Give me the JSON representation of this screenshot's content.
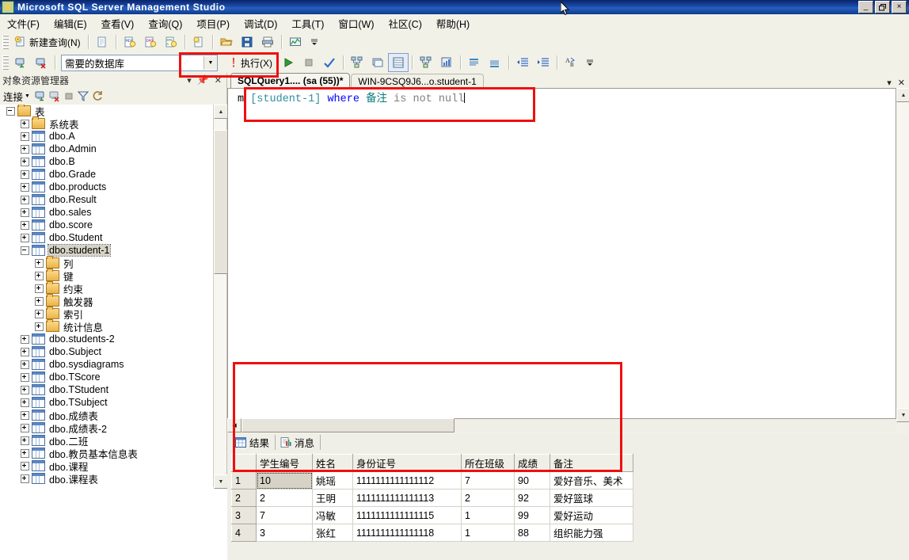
{
  "window": {
    "title": "Microsoft SQL Server Management Studio",
    "minimize": "_",
    "restore": "❐",
    "close": "×"
  },
  "menubar": {
    "items": [
      {
        "label": "文件(F)"
      },
      {
        "label": "编辑(E)"
      },
      {
        "label": "查看(V)"
      },
      {
        "label": "查询(Q)"
      },
      {
        "label": "项目(P)"
      },
      {
        "label": "调试(D)"
      },
      {
        "label": "工具(T)"
      },
      {
        "label": "窗口(W)"
      },
      {
        "label": "社区(C)"
      },
      {
        "label": "帮助(H)"
      }
    ]
  },
  "toolbar1": {
    "new_query_label": "新建查询(N)",
    "icons": [
      "new-query-icon",
      "new-database-engine-query-icon",
      "new-mdx-query-icon",
      "new-dmx-query-icon",
      "new-xmla-query-icon",
      "new-file-icon",
      "open-file-icon",
      "save-icon",
      "print-icon",
      "activity-monitor-icon",
      "toolbar-overflow-icon"
    ]
  },
  "toolbar2": {
    "database_value": "需要的数据库",
    "execute_label": "执行(X)",
    "icons": [
      "connect-object-explorer-icon",
      "disconnect-icon",
      "execute-warning-icon",
      "debug-play-icon",
      "stop-icon",
      "parse-check-icon",
      "display-estimated-plan-icon",
      "query-options-icon",
      "results-to-text-icon",
      "results-to-grid-icon",
      "results-to-file-icon",
      "include-actual-plan-icon",
      "include-client-statistics-icon",
      "comment-icon",
      "uncomment-icon",
      "decrease-indent-icon",
      "increase-indent-icon",
      "spell-check-icon",
      "toolbar-overflow-icon"
    ]
  },
  "object_explorer": {
    "title": "对象资源管理器",
    "connect_label": "连接",
    "toolbar_icons": [
      "connect-icon",
      "disconnect-icon",
      "stop-icon",
      "filter-icon",
      "refresh-icon"
    ],
    "header_icons": [
      "dropdown-icon",
      "pin-icon",
      "close-icon"
    ],
    "tree": [
      {
        "label": "表",
        "type": "folder",
        "indent": 0,
        "state": "minus"
      },
      {
        "label": "系统表",
        "type": "folder",
        "indent": 1,
        "state": "plus"
      },
      {
        "label": "dbo.A",
        "type": "table",
        "indent": 1,
        "state": "plus"
      },
      {
        "label": "dbo.Admin",
        "type": "table",
        "indent": 1,
        "state": "plus"
      },
      {
        "label": "dbo.B",
        "type": "table",
        "indent": 1,
        "state": "plus"
      },
      {
        "label": "dbo.Grade",
        "type": "table",
        "indent": 1,
        "state": "plus"
      },
      {
        "label": "dbo.products",
        "type": "table",
        "indent": 1,
        "state": "plus"
      },
      {
        "label": "dbo.Result",
        "type": "table",
        "indent": 1,
        "state": "plus"
      },
      {
        "label": "dbo.sales",
        "type": "table",
        "indent": 1,
        "state": "plus"
      },
      {
        "label": "dbo.score",
        "type": "table",
        "indent": 1,
        "state": "plus"
      },
      {
        "label": "dbo.Student",
        "type": "table",
        "indent": 1,
        "state": "plus"
      },
      {
        "label": "dbo.student-1",
        "type": "table",
        "indent": 1,
        "state": "minus",
        "selected": true
      },
      {
        "label": "列",
        "type": "folder",
        "indent": 2,
        "state": "plus"
      },
      {
        "label": "键",
        "type": "folder",
        "indent": 2,
        "state": "plus"
      },
      {
        "label": "约束",
        "type": "folder",
        "indent": 2,
        "state": "plus"
      },
      {
        "label": "触发器",
        "type": "folder",
        "indent": 2,
        "state": "plus"
      },
      {
        "label": "索引",
        "type": "folder",
        "indent": 2,
        "state": "plus"
      },
      {
        "label": "统计信息",
        "type": "folder",
        "indent": 2,
        "state": "plus"
      },
      {
        "label": "dbo.students-2",
        "type": "table",
        "indent": 1,
        "state": "plus"
      },
      {
        "label": "dbo.Subject",
        "type": "table",
        "indent": 1,
        "state": "plus"
      },
      {
        "label": "dbo.sysdiagrams",
        "type": "table",
        "indent": 1,
        "state": "plus"
      },
      {
        "label": "dbo.TScore",
        "type": "table",
        "indent": 1,
        "state": "plus"
      },
      {
        "label": "dbo.TStudent",
        "type": "table",
        "indent": 1,
        "state": "plus"
      },
      {
        "label": "dbo.TSubject",
        "type": "table",
        "indent": 1,
        "state": "plus"
      },
      {
        "label": "dbo.成绩表",
        "type": "table",
        "indent": 1,
        "state": "plus"
      },
      {
        "label": "dbo.成绩表-2",
        "type": "table",
        "indent": 1,
        "state": "plus"
      },
      {
        "label": "dbo.二班",
        "type": "table",
        "indent": 1,
        "state": "plus"
      },
      {
        "label": "dbo.教员基本信息表",
        "type": "table",
        "indent": 1,
        "state": "plus"
      },
      {
        "label": "dbo.课程",
        "type": "table",
        "indent": 1,
        "state": "plus"
      },
      {
        "label": "dbo.课程表",
        "type": "table",
        "indent": 1,
        "state": "plus"
      }
    ]
  },
  "editor": {
    "tabs": [
      {
        "label": "SQLQuery1.... (sa (55))*",
        "active": true
      },
      {
        "label": "WIN-9CSQ9J6...o.student-1",
        "active": false
      }
    ],
    "tab_icons": [
      "tab-dropdown-icon",
      "tab-close-icon"
    ],
    "code_tokens": [
      {
        "text": "m ",
        "cls": "k-plain"
      },
      {
        "text": "[student-1]",
        "cls": "k-ident"
      },
      {
        "text": " ",
        "cls": "k-plain"
      },
      {
        "text": "where",
        "cls": "k-kw"
      },
      {
        "text": " ",
        "cls": "k-plain"
      },
      {
        "text": "备注",
        "cls": "k-cn"
      },
      {
        "text": " ",
        "cls": "k-plain"
      },
      {
        "text": "is not null",
        "cls": "k-gray"
      }
    ]
  },
  "results": {
    "tabs": [
      {
        "label": "结果",
        "icon": "results-grid-icon"
      },
      {
        "label": "消息",
        "icon": "messages-icon"
      }
    ],
    "columns": [
      "学生编号",
      "姓名",
      "身份证号",
      "所在班级",
      "成绩",
      "备注"
    ],
    "rows": [
      {
        "n": "1",
        "cells": [
          "10",
          "姚瑶",
          "1111111111111112",
          "7",
          "90",
          "爱好音乐、美术"
        ]
      },
      {
        "n": "2",
        "cells": [
          "2",
          "王明",
          "1111111111111113",
          "2",
          "92",
          "爱好篮球"
        ]
      },
      {
        "n": "3",
        "cells": [
          "7",
          "冯敏",
          "1111111111111115",
          "1",
          "99",
          "爱好运动"
        ]
      },
      {
        "n": "4",
        "cells": [
          "3",
          "张红",
          "1111111111111118",
          "1",
          "88",
          "组织能力强"
        ]
      }
    ]
  },
  "annotations": {
    "highlight_color": "#ef0f0f",
    "boxes": [
      "execute-button-box",
      "sql-statement-box",
      "results-grid-box"
    ]
  }
}
